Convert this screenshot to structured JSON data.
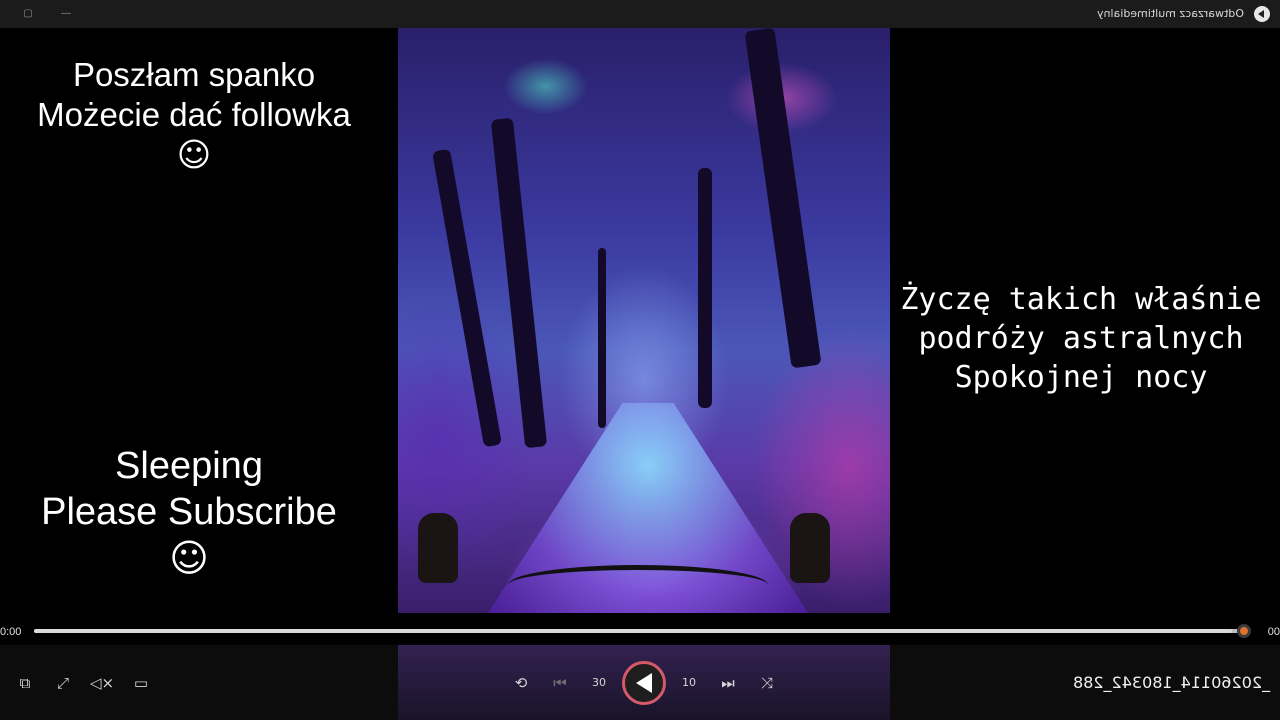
{
  "window": {
    "title": "Odtwarzacz multimedialny",
    "title_mirrored": true
  },
  "overlay": {
    "left_top": {
      "line1": "Poszłam spanko",
      "line2": "Możecie dać followka",
      "emoji": "☺"
    },
    "left_bottom": {
      "line1": "Sleeping",
      "line2": "Please Subscribe",
      "emoji": "☺"
    },
    "right": {
      "line1": "Życzę takich właśnie",
      "line2": "podróży astralnych",
      "line3": "Spokojnej nocy"
    }
  },
  "timeline": {
    "elapsed": "0:00",
    "duration": "00",
    "progress_fraction": 0.99,
    "thumb_color": "#e0702f"
  },
  "controls": {
    "file_name": "_20260114_180342_288",
    "file_name_mirrored": true,
    "skip_back_seconds": "30",
    "skip_forward_seconds": "10",
    "icons": {
      "mini_player": "miniplayer-icon",
      "fullscreen": "fullscreen-icon",
      "volume": "volume-icon",
      "captions": "captions-icon",
      "repeat": "repeat-off-icon",
      "previous": "previous-icon",
      "play": "play-icon",
      "next": "next-icon",
      "shuffle": "shuffle-icon"
    },
    "accent_color": "#d45a6a"
  }
}
